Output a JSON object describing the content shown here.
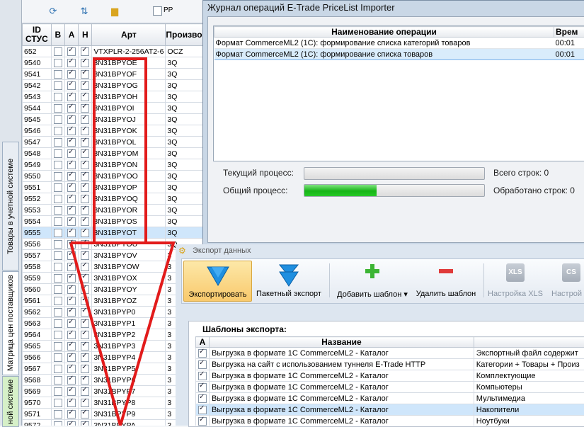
{
  "sidebar": {
    "tabs": [
      {
        "label": "Товары в учетной системе"
      },
      {
        "label": "Матрица цен поставщиков"
      },
      {
        "label": "ной системе"
      }
    ]
  },
  "toolbar": {
    "pp_label": "PP"
  },
  "grid": {
    "headers": {
      "id": "ID СТУС",
      "b": "В",
      "a": "А",
      "h": "Н",
      "art": "Арт",
      "maker": "Произво"
    },
    "rows": [
      {
        "id": "652",
        "b": false,
        "a": true,
        "h": true,
        "art": "VTXPLR-2-256AT2-6",
        "maker": "OCZ"
      },
      {
        "id": "9540",
        "b": false,
        "a": true,
        "h": true,
        "art": "3N31BPYOE",
        "maker": "3Q"
      },
      {
        "id": "9541",
        "b": false,
        "a": true,
        "h": true,
        "art": "3N31BPYOF",
        "maker": "3Q"
      },
      {
        "id": "9542",
        "b": false,
        "a": true,
        "h": true,
        "art": "3N31BPYOG",
        "maker": "3Q"
      },
      {
        "id": "9543",
        "b": false,
        "a": true,
        "h": true,
        "art": "3N31BPYOH",
        "maker": "3Q"
      },
      {
        "id": "9544",
        "b": false,
        "a": true,
        "h": true,
        "art": "3N31BPYOI",
        "maker": "3Q"
      },
      {
        "id": "9545",
        "b": false,
        "a": true,
        "h": true,
        "art": "3N31BPYOJ",
        "maker": "3Q"
      },
      {
        "id": "9546",
        "b": false,
        "a": true,
        "h": true,
        "art": "3N31BPYOK",
        "maker": "3Q"
      },
      {
        "id": "9547",
        "b": false,
        "a": true,
        "h": true,
        "art": "3N31BPYOL",
        "maker": "3Q"
      },
      {
        "id": "9548",
        "b": false,
        "a": true,
        "h": true,
        "art": "3N31BPYOM",
        "maker": "3Q"
      },
      {
        "id": "9549",
        "b": false,
        "a": true,
        "h": true,
        "art": "3N31BPYON",
        "maker": "3Q"
      },
      {
        "id": "9550",
        "b": false,
        "a": true,
        "h": true,
        "art": "3N31BPYOO",
        "maker": "3Q"
      },
      {
        "id": "9551",
        "b": false,
        "a": true,
        "h": true,
        "art": "3N31BPYOP",
        "maker": "3Q"
      },
      {
        "id": "9552",
        "b": false,
        "a": true,
        "h": true,
        "art": "3N31BPYOQ",
        "maker": "3Q"
      },
      {
        "id": "9553",
        "b": false,
        "a": true,
        "h": true,
        "art": "3N31BPYOR",
        "maker": "3Q"
      },
      {
        "id": "9554",
        "b": false,
        "a": true,
        "h": true,
        "art": "3N31BPYOS",
        "maker": "3Q"
      },
      {
        "id": "9555",
        "b": false,
        "a": true,
        "h": true,
        "art": "3N31BPYOT",
        "maker": "3Q",
        "selected": true
      },
      {
        "id": "9556",
        "b": false,
        "a": true,
        "h": true,
        "art": "3N31BPYOU",
        "maker": "3Q"
      },
      {
        "id": "9557",
        "b": false,
        "a": true,
        "h": true,
        "art": "3N31BPYOV",
        "maker": "3"
      },
      {
        "id": "9558",
        "b": false,
        "a": true,
        "h": true,
        "art": "3N31BPYOW",
        "maker": "3"
      },
      {
        "id": "9559",
        "b": false,
        "a": true,
        "h": true,
        "art": "3N31BPYOX",
        "maker": "3"
      },
      {
        "id": "9560",
        "b": false,
        "a": true,
        "h": true,
        "art": "3N31BPYOY",
        "maker": "3"
      },
      {
        "id": "9561",
        "b": false,
        "a": true,
        "h": true,
        "art": "3N31BPYOZ",
        "maker": "3"
      },
      {
        "id": "9562",
        "b": false,
        "a": true,
        "h": true,
        "art": "3N31BPYP0",
        "maker": "3"
      },
      {
        "id": "9563",
        "b": false,
        "a": true,
        "h": true,
        "art": "3N31BPYP1",
        "maker": "3"
      },
      {
        "id": "9564",
        "b": false,
        "a": true,
        "h": true,
        "art": "3N31BPYP2",
        "maker": "3"
      },
      {
        "id": "9565",
        "b": false,
        "a": true,
        "h": true,
        "art": "3N31BPYP3",
        "maker": "3"
      },
      {
        "id": "9566",
        "b": false,
        "a": true,
        "h": true,
        "art": "3N31BPYP4",
        "maker": "3"
      },
      {
        "id": "9567",
        "b": false,
        "a": true,
        "h": true,
        "art": "3N31BPYP5",
        "maker": "3"
      },
      {
        "id": "9568",
        "b": false,
        "a": true,
        "h": true,
        "art": "3N31BPYP6",
        "maker": "3"
      },
      {
        "id": "9569",
        "b": false,
        "a": true,
        "h": true,
        "art": "3N31BPYP7",
        "maker": "3"
      },
      {
        "id": "9570",
        "b": false,
        "a": true,
        "h": true,
        "art": "3N31BPYP8",
        "maker": "3"
      },
      {
        "id": "9571",
        "b": false,
        "a": true,
        "h": true,
        "art": "3N31BPYP9",
        "maker": "3"
      },
      {
        "id": "9572",
        "b": false,
        "a": true,
        "h": true,
        "art": "3N31BPYPA",
        "maker": "3"
      }
    ]
  },
  "log": {
    "title": "Журнал операций E-Trade PriceList Importer",
    "headers": {
      "name": "Наименование операции",
      "time": "Врем"
    },
    "rows": [
      {
        "name": "Формат CommerceML2 (1С): формирование списка категорий товаров",
        "time": "00:01"
      },
      {
        "name": "Формат CommerceML2 (1С): формирование списка товаров",
        "time": "00:01",
        "selected": true
      }
    ],
    "current_label": "Текущий процесс:",
    "total_label": "Общий процесс:",
    "current_progress": 0,
    "total_progress": 0.4,
    "rows_total": "Всего строк: 0",
    "rows_done": "Обработано строк: 0"
  },
  "export": {
    "title": "Экспорт данных",
    "buttons": {
      "export": "Экспортировать",
      "batch": "Пакетный экспорт",
      "add": "Добавить шаблон",
      "delete": "Удалить шаблон",
      "xls_settings": "Настройка XLS",
      "csv_settings": "Настрой",
      "xls_icon": "XLS",
      "csv_icon": "CS"
    },
    "templates_title": "Шаблоны экспорта:",
    "headers": {
      "a": "А",
      "name": "Название",
      "desc": ""
    },
    "rows": [
      {
        "a": true,
        "name": "Выгрузка в формате 1С CommerceML2 - Каталог",
        "desc": "Экспортный файл содержит"
      },
      {
        "a": true,
        "name": "Выгрузка на сайт с использованием туннеля E-Trade HTTP",
        "desc": "Категории + Товары + Произ"
      },
      {
        "a": true,
        "name": "Выгрузка в формате 1С CommerceML2 - Каталог",
        "desc": "Комплектующие"
      },
      {
        "a": true,
        "name": "Выгрузка в формате 1С CommerceML2 - Каталог",
        "desc": "Компьютеры"
      },
      {
        "a": true,
        "name": "Выгрузка в формате 1С CommerceML2 - Каталог",
        "desc": "Мультимедиа"
      },
      {
        "a": true,
        "name": "Выгрузка в формате 1С CommerceML2 - Каталог",
        "desc": "Накопители",
        "selected": true
      },
      {
        "a": true,
        "name": "Выгрузка в формате 1С CommerceML2 - Каталог",
        "desc": "Ноутбуки"
      }
    ]
  },
  "colors": {
    "accent_red": "#e21b1b",
    "progress_green": "#16b516",
    "selection": "#cfe6fb"
  }
}
